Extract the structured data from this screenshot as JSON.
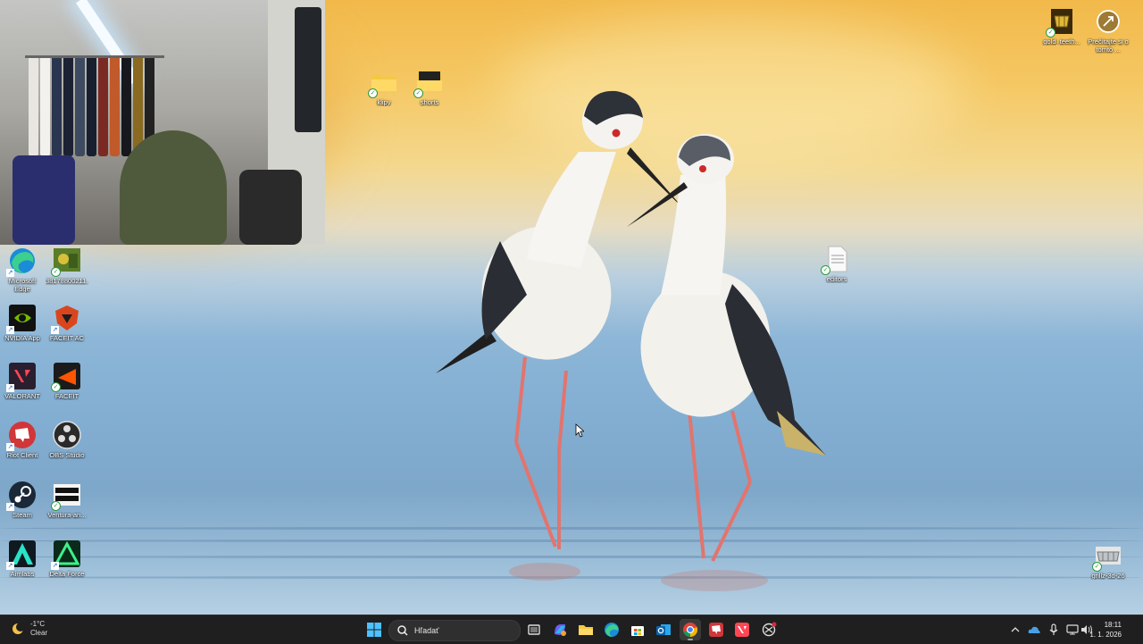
{
  "desktop": {
    "left_icons": [
      {
        "label": "Microsoft Edge",
        "icon": "edge-icon"
      },
      {
        "label": "38178800211...",
        "icon": "image-thumbnail-icon"
      },
      {
        "label": "NVIDIA App",
        "icon": "nvidia-icon"
      },
      {
        "label": "FACEIT AC",
        "icon": "faceit-ac-icon"
      },
      {
        "label": "VALORANT",
        "icon": "valorant-icon"
      },
      {
        "label": "FACEIT",
        "icon": "faceit-icon"
      },
      {
        "label": "Riot Client",
        "icon": "riot-client-icon"
      },
      {
        "label": "OBS Studio",
        "icon": "obs-icon"
      },
      {
        "label": "Steam",
        "icon": "steam-icon"
      },
      {
        "label": "Ventura-an...",
        "icon": "whitetower-icon"
      },
      {
        "label": "Aimlabs",
        "icon": "aimlabs-icon"
      },
      {
        "label": "Delta Force",
        "icon": "delta-force-icon"
      }
    ],
    "folders": [
      {
        "label": "klipy",
        "icon": "folder-icon"
      },
      {
        "label": "shorts",
        "icon": "folder-icon"
      }
    ],
    "files": [
      {
        "label": "editors",
        "icon": "text-file-icon"
      },
      {
        "label": "grillz-3d-26",
        "icon": "image-thumbnail-icon"
      }
    ],
    "top_right_icons": [
      {
        "label": "gold_teeth...",
        "icon": "image-thumbnail-icon"
      },
      {
        "label": "Prečítajte si o tomto ...",
        "icon": "spotlight-info-icon"
      }
    ]
  },
  "taskbar": {
    "weather": {
      "temperature": "-1°C",
      "condition": "Clear"
    },
    "search_placeholder": "Hľadať",
    "apps": [
      "windows-start-icon",
      "task-view-icon",
      "copilot-icon",
      "file-explorer-icon",
      "edge-icon",
      "microsoft-store-icon",
      "outlook-icon",
      "chrome-icon",
      "riot-client-icon",
      "valorant-icon",
      "snipping-tool-icon"
    ],
    "active_app": "chrome-icon",
    "tray": [
      "chevron-up-icon",
      "onedrive-icon",
      "microphone-icon",
      "network-icon",
      "volume-icon"
    ],
    "time": "18:11",
    "date": "1. 1. 2026"
  },
  "colors": {
    "taskbar": "#1f1f1f",
    "accent": "#0078d4"
  }
}
